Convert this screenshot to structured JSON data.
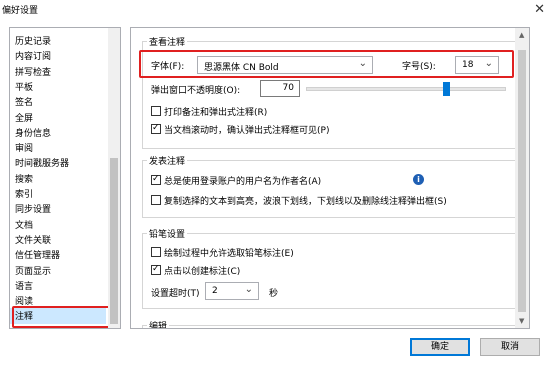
{
  "window": {
    "title": "偏好设置",
    "close_label": "✕"
  },
  "sidebar": {
    "items": [
      "历史记录",
      "内容订阅",
      "拼写检查",
      "平板",
      "签名",
      "全屏",
      "身份信息",
      "审阅",
      "时间戳服务器",
      "搜索",
      "索引",
      "同步设置",
      "文档",
      "文件关联",
      "信任管理器",
      "页面显示",
      "语言",
      "阅读",
      "注释"
    ],
    "selected": "注释"
  },
  "view_group": {
    "title": "查看注释",
    "font_label": "字体(F):",
    "font_value": "思源黑体 CN Bold",
    "size_label": "字号(S):",
    "size_value": "18",
    "opacity_label": "弹出窗口不透明度(O):",
    "opacity_value": "70",
    "opacity_level_percent": 70,
    "print_label": "打印备注和弹出式注释(R)",
    "print_checked": false,
    "scroll_label": "当文档滚动时，确认弹出式注释框可见(P)",
    "scroll_checked": true
  },
  "publish_group": {
    "title": "发表注释",
    "username_label": "总是使用登录账户的用户名为作者名(A)",
    "username_checked": true,
    "info_icon": "info-icon",
    "copy_label": "复制选择的文本到高亮，波浪下划线，下划线以及删除线注释弹出框(S)",
    "copy_checked": false
  },
  "pencil_group": {
    "title": "铅笔设置",
    "select_label": "绘制过程中允许选取铅笔标注(E)",
    "select_checked": false,
    "click_label": "点击以创建标注(C)",
    "click_checked": true,
    "timeout_label": "设置超时(T)",
    "timeout_value": "2",
    "timeout_unit": "秒"
  },
  "edit_group": {
    "title": "编辑"
  },
  "footer": {
    "ok_label": "确定",
    "cancel_label": "取消"
  },
  "colors": {
    "accent": "#0078d7",
    "highlight": "#e02020",
    "selection": "#cce8ff"
  }
}
